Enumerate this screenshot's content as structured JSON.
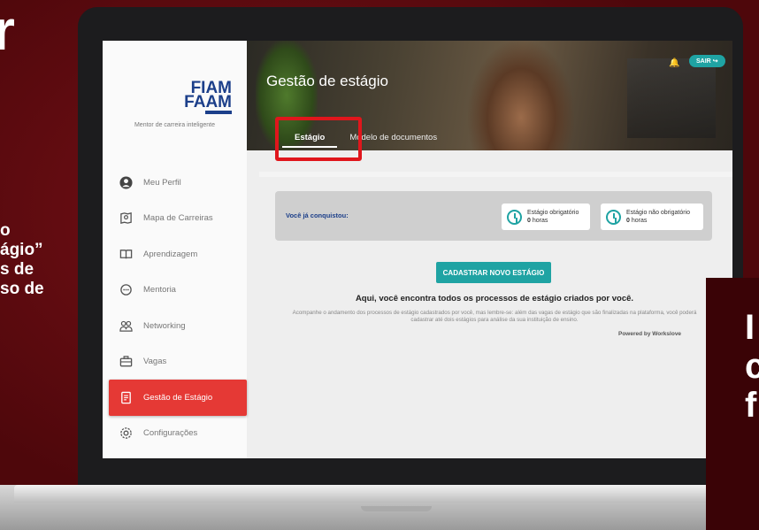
{
  "promo": {
    "big_letter": "r",
    "lines": [
      "o",
      "ágio”",
      "s de",
      "so de"
    ],
    "right_letters": [
      "I",
      "c",
      "f"
    ]
  },
  "brand": {
    "logo_line1": "FIAM",
    "logo_line2": "FAAM",
    "tagline": "Mentor de carreira inteligente"
  },
  "sidebar": {
    "items": [
      {
        "label": "Meu Perfil",
        "icon": "user-circle-icon"
      },
      {
        "label": "Mapa de Carreiras",
        "icon": "map-icon"
      },
      {
        "label": "Aprendizagem",
        "icon": "book-icon"
      },
      {
        "label": "Mentoria",
        "icon": "chat-icon"
      },
      {
        "label": "Networking",
        "icon": "people-icon"
      },
      {
        "label": "Vagas",
        "icon": "briefcase-icon"
      },
      {
        "label": "Gestão de Estágio",
        "icon": "document-icon",
        "active": true
      },
      {
        "label": "Configurações",
        "icon": "gear-icon"
      }
    ]
  },
  "header": {
    "title": "Gestão de estágio",
    "logout_label": "SAIR",
    "tabs": [
      {
        "label": "Estágio",
        "active": true
      },
      {
        "label": "Modelo de documentos"
      }
    ]
  },
  "achievements": {
    "label": "Você já conquistou:",
    "cards": [
      {
        "title": "Estágio obrigatório",
        "value": "0",
        "unit": "horas"
      },
      {
        "title": "Estágio não obrigatório",
        "value": "0",
        "unit": "horas"
      }
    ]
  },
  "cta_label": "CADASTRAR NOVO ESTÁGIO",
  "headline": "Aqui, você encontra todos os processos de estágio criados por você.",
  "description": "Acompanhe o andamento dos processos de estágio cadastrados por você, mas lembre-se: além das vagas de estágio que são finalizadas na plataforma, você poderá cadastrar até dois estágios para análise da sua instituição de ensino.",
  "powered_by": "Powered by Workslove",
  "colors": {
    "accent": "#1fa3a3",
    "active_nav": "#e53935",
    "highlight": "#e0161c",
    "background": "#5c0a0e"
  }
}
